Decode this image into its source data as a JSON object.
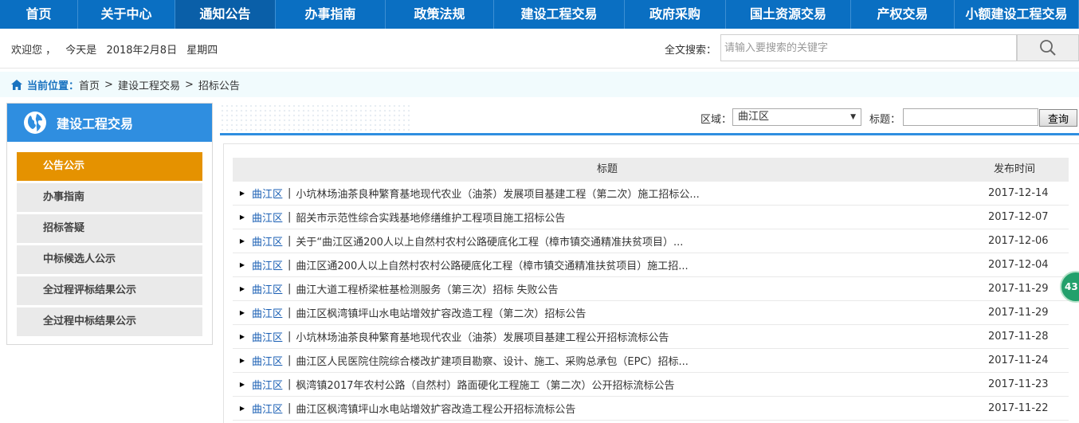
{
  "nav": [
    {
      "label": "首页",
      "width": 98
    },
    {
      "label": "关于中心",
      "width": 122
    },
    {
      "label": "通知公告",
      "width": 126,
      "active": true
    },
    {
      "label": "办事指南",
      "width": 138
    },
    {
      "label": "政策法规",
      "width": 136
    },
    {
      "label": "建设工程交易",
      "width": 164
    },
    {
      "label": "政府采购",
      "width": 127
    },
    {
      "label": "国土资源交易",
      "width": 157
    },
    {
      "label": "产权交易",
      "width": 130
    },
    {
      "label": "小额建设工程交易",
      "width": 156
    }
  ],
  "welcome": {
    "greeting": "欢迎您 ，",
    "today_label": "今天是",
    "date": "2018年2月8日",
    "weekday": "星期四"
  },
  "search": {
    "label": "全文搜索：",
    "placeholder": "请输入要搜索的关键字"
  },
  "breadcrumb": {
    "label": "当前位置：",
    "items": [
      "首页",
      "建设工程交易",
      "招标公告"
    ],
    "separator": ">"
  },
  "sidebar": {
    "title": "建设工程交易",
    "items": [
      {
        "label": "公告公示",
        "active": true
      },
      {
        "label": "办事指南"
      },
      {
        "label": "招标答疑"
      },
      {
        "label": "中标候选人公示"
      },
      {
        "label": "全过程评标结果公示"
      },
      {
        "label": "全过程中标结果公示"
      }
    ]
  },
  "filter": {
    "area_label": "区域：",
    "area_value": "曲江区",
    "title_label": "标题：",
    "query_label": "查询"
  },
  "table": {
    "headers": {
      "title": "标题",
      "date": "发布时间"
    },
    "separator": "|",
    "rows": [
      {
        "area": "曲江区",
        "title": "小坑林场油茶良种繁育基地现代农业（油茶）发展项目基建工程（第二次）施工招标公...",
        "date": "2017-12-14"
      },
      {
        "area": "曲江区",
        "title": "韶关市示范性综合实践基地修缮维护工程项目施工招标公告",
        "date": "2017-12-07"
      },
      {
        "area": "曲江区",
        "title": "关于“曲江区通200人以上自然村农村公路硬底化工程（樟市镇交通精准扶贫项目）...",
        "date": "2017-12-06"
      },
      {
        "area": "曲江区",
        "title": "曲江区通200人以上自然村农村公路硬底化工程（樟市镇交通精准扶贫项目）施工招...",
        "date": "2017-12-04"
      },
      {
        "area": "曲江区",
        "title": "曲江大道工程桥梁桩基检测服务（第三次）招标 失败公告",
        "date": "2017-11-29"
      },
      {
        "area": "曲江区",
        "title": "曲江区枫湾镇坪山水电站增效扩容改造工程（第二次）招标公告",
        "date": "2017-11-29"
      },
      {
        "area": "曲江区",
        "title": "小坑林场油茶良种繁育基地现代农业（油茶）发展项目基建工程公开招标流标公告",
        "date": "2017-11-28"
      },
      {
        "area": "曲江区",
        "title": "曲江区人民医院住院综合楼改扩建项目勘察、设计、施工、采购总承包（EPC）招标...",
        "date": "2017-11-24"
      },
      {
        "area": "曲江区",
        "title": "枫湾镇2017年农村公路（自然村）路面硬化工程施工（第二次）公开招标流标公告",
        "date": "2017-11-23"
      },
      {
        "area": "曲江区",
        "title": "曲江区枫湾镇坪山水电站增效扩容改造工程公开招标流标公告",
        "date": "2017-11-22"
      }
    ]
  },
  "float_badge": "43",
  "colors": {
    "nav_bg": "#0a6fc2",
    "sidebar_head": "#2f8ee0",
    "active_item": "#e59200",
    "link": "#1a5fb4"
  }
}
